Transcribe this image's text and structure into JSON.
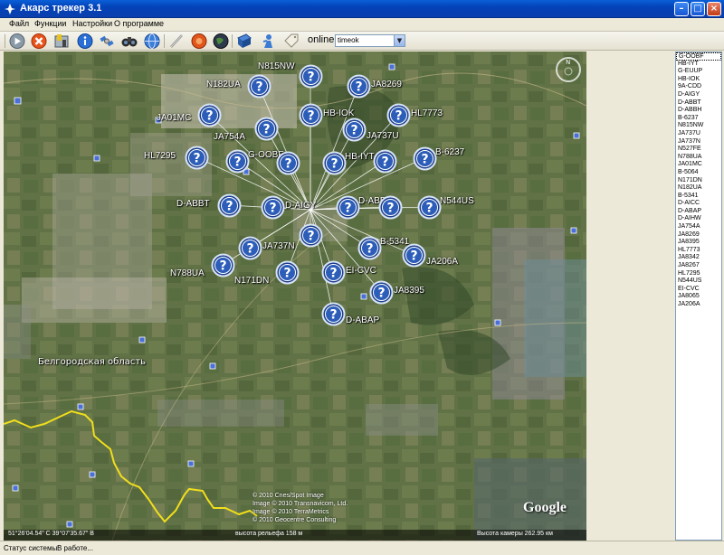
{
  "window": {
    "title": "Акарс трекер 3.1"
  },
  "menu": [
    "Файл",
    "Функции",
    "Настройки",
    "О программе"
  ],
  "toolbar": {
    "buttons": [
      "play-icon",
      "stop-icon",
      "settings-icon",
      "info-icon",
      "satellite-icon",
      "binoculars-icon",
      "globe-icon",
      "antenna-icon",
      "marker-icon",
      "earth-icon",
      "book-icon",
      "person-icon",
      "tag-icon"
    ],
    "online_label": "online",
    "mode_value": "timeok"
  },
  "map": {
    "region_label": "Белгородская область",
    "credits": [
      "© 2010 Cnes/Spot Image",
      "Image © 2010 Transnavicom, Ltd.",
      "Image © 2010 TerraMetrics",
      "© 2010 Geocentre Consulting"
    ],
    "logo": "Google",
    "footer": {
      "coords": "51°26'04.54\" С   39°07'35.67\" В",
      "elevation": "высота рельефа  158 м",
      "camera": "Высота камеры   262.95 км"
    },
    "hub": "D-AIGY",
    "planes": [
      {
        "label": "N815NW"
      },
      {
        "label": "N182UA"
      },
      {
        "label": "JA8269"
      },
      {
        "label": "JA01MC"
      },
      {
        "label": "HB-IOK"
      },
      {
        "label": "HL7773"
      },
      {
        "label": "JA754A"
      },
      {
        "label": "JA737U"
      },
      {
        "label": "HL7295"
      },
      {
        "label": "G-OOBF"
      },
      {
        "label": "HB-IYT"
      },
      {
        "label": "B-6237"
      },
      {
        "label": "D-ABBT"
      },
      {
        "label": "D-AIGY"
      },
      {
        "label": "D-ABBH"
      },
      {
        "label": "N544US"
      },
      {
        "label": "JA737N"
      },
      {
        "label": "B-5341"
      },
      {
        "label": "N788UA"
      },
      {
        "label": "JA206A"
      },
      {
        "label": "EI-CVC"
      },
      {
        "label": "N171DN"
      },
      {
        "label": "JA8395"
      },
      {
        "label": "D-ABAP"
      }
    ]
  },
  "flight_list": [
    "G-OOBF",
    "HB-IYT",
    "G-EUUP",
    "HB-IOK",
    "9A-CDD",
    "D-AIGY",
    "D-ABBT",
    "D-ABBH",
    "B-6237",
    "N815NW",
    "JA737U",
    "JA737N",
    "N527FE",
    "N788UA",
    "JA01MC",
    "B-5064",
    "N171DN",
    "N182UA",
    "B-5341",
    "D-AICC",
    "D-ABAP",
    "D-AIHW",
    "JA754A",
    "JA8269",
    "JA8395",
    "HL7773",
    "JA8342",
    "JA8267",
    "HL7295",
    "N544US",
    "EI-CVC",
    "JA8065",
    "JA206A"
  ],
  "status": {
    "label": "Статус системы:",
    "value": "В работе..."
  },
  "colors": {
    "titlebar": "#0a4fc8",
    "marker": "#1d3f8c",
    "border": "#d7e3f4",
    "path": "#f1de1c"
  }
}
